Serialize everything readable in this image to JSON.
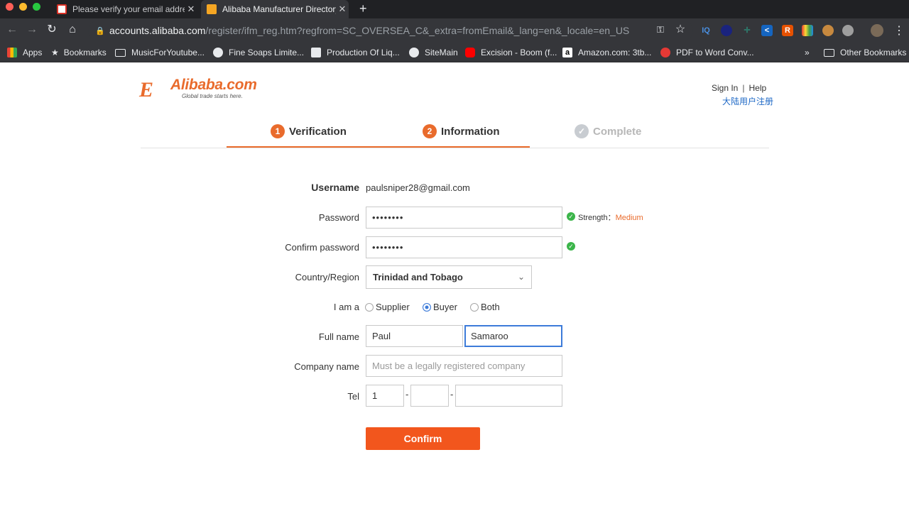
{
  "browser": {
    "tabs": [
      {
        "title": "Please verify your email address",
        "active": false
      },
      {
        "title": "Alibaba Manufacturer Directory",
        "active": true
      }
    ],
    "new_tab": "+",
    "url_host": "accounts.alibaba.com",
    "url_path": "/register/ifm_reg.htm?regfrom=SC_OVERSEA_C&_extra=fromEmail&_lang=en&_locale=en_US",
    "bookmarks": [
      {
        "label": "Apps",
        "icon": "apps-grid-icon"
      },
      {
        "label": "Bookmarks",
        "icon": "star-icon"
      },
      {
        "label": "MusicForYoutube...",
        "icon": "folder-icon"
      },
      {
        "label": "Fine Soaps Limite...",
        "icon": "globe-icon"
      },
      {
        "label": "Production Of Liq...",
        "icon": "page-icon"
      },
      {
        "label": "SiteMain",
        "icon": "globe-icon"
      },
      {
        "label": "Excision - Boom (f...",
        "icon": "youtube-icon"
      },
      {
        "label": "Amazon.com: 3tb...",
        "icon": "amazon-icon"
      },
      {
        "label": "PDF to Word Conv...",
        "icon": "pdf-icon"
      }
    ],
    "bookmarks_overflow": "»",
    "other_bookmarks": "Other Bookmarks"
  },
  "header": {
    "logo_word": "Alibaba.com",
    "logo_tagline": "Global trade starts here.",
    "sign_in": "Sign In",
    "separator": "|",
    "help": "Help",
    "cn_register": "大陆用户注册"
  },
  "steps": [
    {
      "num": "1",
      "label": "Verification"
    },
    {
      "num": "2",
      "label": "Information"
    },
    {
      "num": "✓",
      "label": "Complete"
    }
  ],
  "form": {
    "username_label": "Username",
    "username_value": "paulsniper28@gmail.com",
    "password_label": "Password",
    "password_value": "••••••••",
    "strength_label": "Strength：",
    "strength_value": "Medium",
    "confirm_label": "Confirm password",
    "confirm_value": "••••••••",
    "country_label": "Country/Region",
    "country_value": "Trinidad and Tobago",
    "iam_label": "I am a",
    "roles": [
      "Supplier",
      "Buyer",
      "Both"
    ],
    "selected_role": "Buyer",
    "fullname_label": "Full name",
    "first_name": "Paul",
    "last_name": "Samaroo",
    "company_label": "Company name",
    "company_placeholder": "Must be a legally registered company",
    "tel_label": "Tel",
    "tel_country": "1",
    "tel_area": "",
    "tel_number": "",
    "tel_dash": "-",
    "confirm_button": "Confirm"
  },
  "colors": {
    "brand_orange": "#e96b2c",
    "button_orange": "#f2561d",
    "link_blue": "#1e68c6",
    "focus_blue": "#3d7bd9",
    "ok_green": "#3bb54a"
  }
}
